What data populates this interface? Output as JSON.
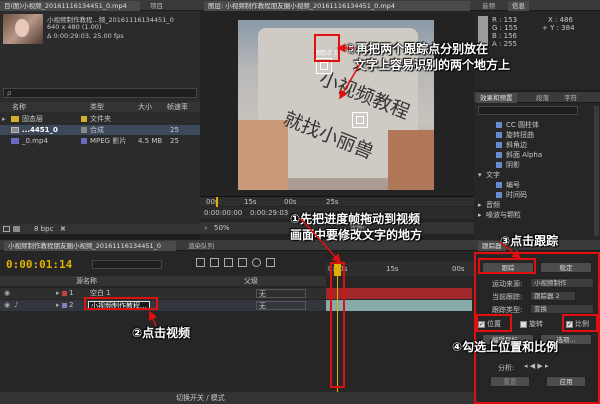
{
  "project": {
    "tab_title": "目(图)小视频_20161116134451_0.mp4",
    "tab_project": "项目",
    "thumb_name": "小视频制作教程...频_20161116134451_0",
    "thumb_dims": "640 x 480 (1.00)",
    "thumb_dur": "Δ 0:00:29:03, 25.00 fps",
    "search_placeholder": "ρ",
    "col_name": "名称",
    "col_type": "类型",
    "col_size": "大小",
    "col_rate": "帧速率",
    "items": [
      {
        "name": "固态层",
        "type": "文件夹",
        "size": "",
        "rate": "",
        "color": "#d4b02a"
      },
      {
        "name": "...4451_0",
        "type": "合成",
        "size": "",
        "rate": "25",
        "color": "#8a8a8a"
      },
      {
        "name": "_0.mp4",
        "type": "MPEG 影片",
        "size": "4.5 MB",
        "rate": "25",
        "color": "#6a6ac0"
      }
    ],
    "bpc": "8 bpc"
  },
  "viewer": {
    "tab_title": "图层: 小视频制作教程朋友圈小视频_20161116134451_0.mp4",
    "track_label_1": "跟踪点 1",
    "track_label_2": "",
    "video_text_1": "小视频教程",
    "video_text_2": "就找小丽兽",
    "ruler_ticks": [
      "00s",
      "15s",
      "00s",
      "25s"
    ],
    "time_display": "0:00:00:00",
    "time_display2": "0:00:29:03",
    "zoom": "50%",
    "view_label": "视图:"
  },
  "info": {
    "tab_audio": "音频",
    "tab_info": "信息",
    "r": "R : 153",
    "g": "G : 155",
    "b": "B : 156",
    "a": "A : 255",
    "x": "X : 486",
    "y": "+ Y : 384"
  },
  "effects": {
    "tab_effects": "效果和预置",
    "tab_align": "段落",
    "tab_char": "字符",
    "items": [
      "CC 圆柱体",
      "旋转扭曲",
      "斜角边",
      "斜面 Alpha",
      "阴影"
    ],
    "sec_text": "文字",
    "text_items": [
      "编号",
      "时间码"
    ],
    "sec_audio": "音频",
    "sec_noise": "噪波与颗粒"
  },
  "timeline": {
    "tab_comp": "小视频制作教程朋友圈小视频_20161116134451_0",
    "tab_render": "渲染队列",
    "timecode": "0:00:01:14",
    "col_source": "源名称",
    "col_parent": "父级",
    "layers": [
      {
        "num": "1",
        "name": "空白 1",
        "parent": "无",
        "color": "#c04040"
      },
      {
        "num": "2",
        "name": "小视频制作教程...",
        "parent": "无",
        "color": "#8080c0"
      }
    ],
    "ruler_ticks": [
      "0:00s",
      "15s",
      "00s"
    ],
    "switch_toggle": "切换开关 / 模式"
  },
  "tracker": {
    "tab": "跟踪器",
    "track_camera": "跟踪",
    "stabilize": "稳定",
    "motion_source_label": "运动来源:",
    "motion_source": "小视频制作",
    "current_track_label": "当前跟踪:",
    "current_track": "跟踪器 2",
    "track_type_label": "跟踪类型:",
    "track_type": "变换",
    "chk_position": "位置",
    "chk_rotation": "旋转",
    "chk_scale": "比例",
    "edit_target": "编辑目标...",
    "options": "选项...",
    "analyze_label": "分析:",
    "reset": "重置",
    "apply": "应用"
  },
  "annotations": {
    "a1_line1": "①先把进度帧拖动到视频",
    "a1_line2": "画面中要修改文字的地方",
    "a2": "②点击视频",
    "a3": "③点击跟踪",
    "a4": "④勾选上位置和比例",
    "a5_line1": "⑤再把两个跟踪点分别放在",
    "a5_line2": "文字上容易识别的两个地方上"
  },
  "colors": {
    "accent_red": "#e01010",
    "timecode_yellow": "#e0b000",
    "bar_red": "#a02828",
    "bar_teal": "#88aaa8"
  }
}
